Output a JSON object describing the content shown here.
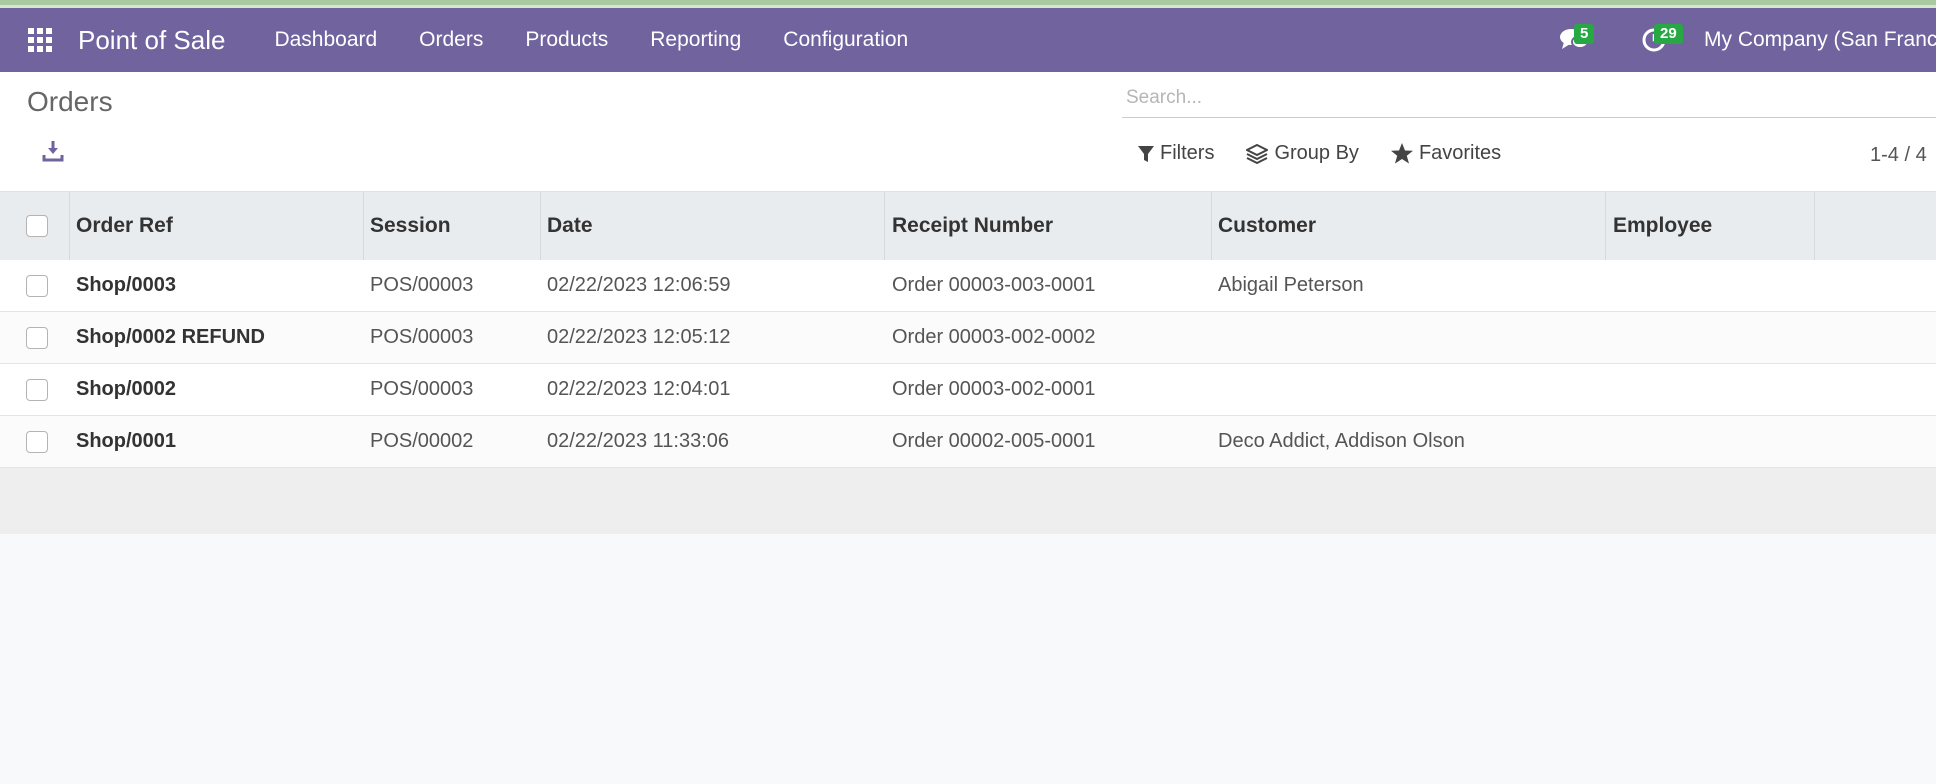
{
  "navbar": {
    "brand": "Point of Sale",
    "menu": [
      "Dashboard",
      "Orders",
      "Products",
      "Reporting",
      "Configuration"
    ],
    "messages_badge": "5",
    "activities_badge": "29",
    "company": "My Company (San Francisco)",
    "color": "#71639e"
  },
  "control_panel": {
    "title": "Orders",
    "search_placeholder": "Search...",
    "filters_label": "Filters",
    "groupby_label": "Group By",
    "favorites_label": "Favorites",
    "pager": "1-4 / 4"
  },
  "table": {
    "headers": [
      "Order Ref",
      "Session",
      "Date",
      "Receipt Number",
      "Customer",
      "Employee"
    ],
    "rows": [
      {
        "ref": "Shop/0003",
        "session": "POS/00003",
        "date": "02/22/2023 12:06:59",
        "receipt": "Order 00003-003-0001",
        "customer": "Abigail Peterson",
        "employee": ""
      },
      {
        "ref": "Shop/0002 REFUND",
        "session": "POS/00003",
        "date": "02/22/2023 12:05:12",
        "receipt": "Order 00003-002-0002",
        "customer": "",
        "employee": ""
      },
      {
        "ref": "Shop/0002",
        "session": "POS/00003",
        "date": "02/22/2023 12:04:01",
        "receipt": "Order 00003-002-0001",
        "customer": "",
        "employee": ""
      },
      {
        "ref": "Shop/0001",
        "session": "POS/00002",
        "date": "02/22/2023 11:33:06",
        "receipt": "Order 00002-005-0001",
        "customer": "Deco Addict, Addison Olson",
        "employee": ""
      }
    ]
  }
}
